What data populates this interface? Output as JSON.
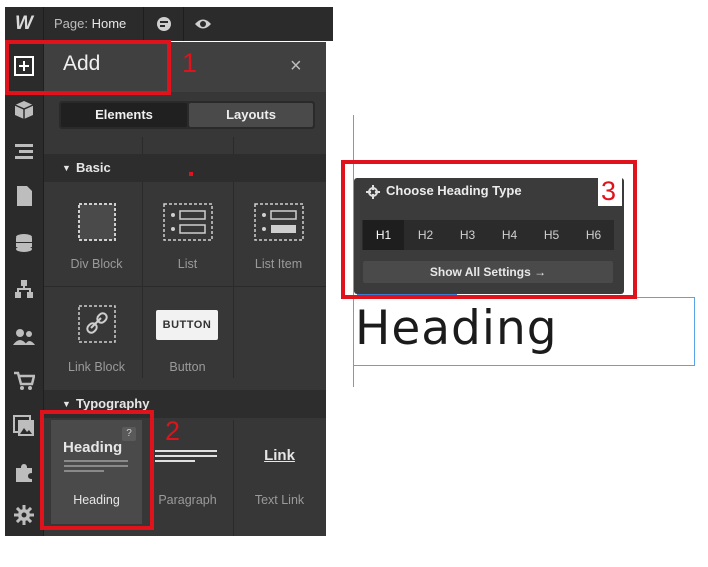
{
  "topbar": {
    "logo": "W",
    "page_prefix": "Page:",
    "page_name": "Home"
  },
  "panel": {
    "title": "Add",
    "close_symbol": "×",
    "tabs": [
      "Elements",
      "Layouts"
    ],
    "sections": [
      {
        "label": "Basic",
        "items": [
          "Div Block",
          "List",
          "List Item",
          "Link Block",
          "Button"
        ]
      },
      {
        "label": "Typography",
        "items": [
          "Heading",
          "Paragraph",
          "Text Link"
        ]
      }
    ],
    "button_preview": "BUTTON",
    "heading_preview": "Heading",
    "link_preview": "Link",
    "help_badge": "?"
  },
  "sidebar_icons": [
    "add-icon",
    "box-icon",
    "navigator-icon",
    "pages-icon",
    "cms-icon",
    "symbols-icon",
    "users-icon",
    "ecommerce-icon",
    "assets-icon",
    "apps-icon",
    "settings-icon"
  ],
  "popup": {
    "title": "Choose Heading Type",
    "levels": [
      "H1",
      "H2",
      "H3",
      "H4",
      "H5",
      "H6"
    ],
    "selected": "H1",
    "show_all": "Show All Settings →"
  },
  "canvas": {
    "heading": "Heading"
  },
  "annotations": [
    "1",
    "2",
    "3"
  ],
  "colors": {
    "annotation": "#e0121c",
    "selection": "#5aa3e6",
    "panel": "#373737"
  }
}
